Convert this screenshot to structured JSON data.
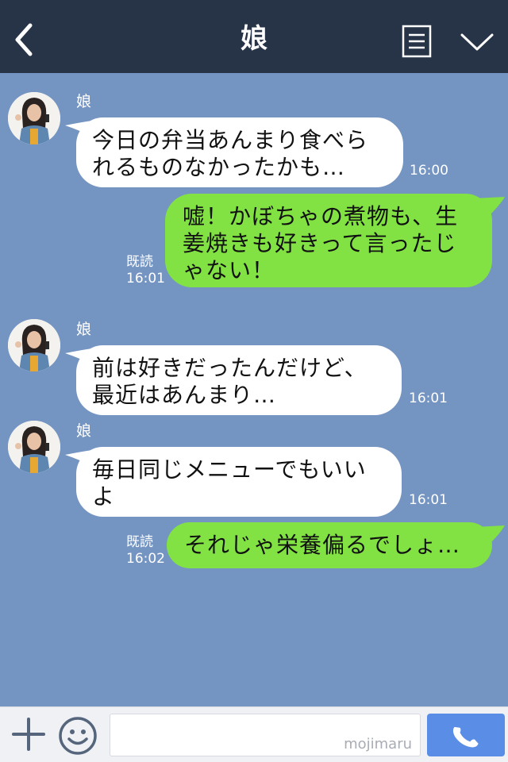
{
  "header": {
    "title": "娘",
    "back_icon": "chevron-left-icon",
    "note_icon": "note-icon",
    "menu_icon": "chevron-down-icon"
  },
  "messages": [
    {
      "side": "left",
      "sender": "娘",
      "lines": [
        "今日の弁当あんまり食べら",
        "れるものなかったかも…"
      ],
      "time": "16:00"
    },
    {
      "side": "right",
      "lines": [
        "嘘！かぼちゃの煮物も、生",
        "姜焼きも好きって言ったじ",
        "ゃない！"
      ],
      "read": "既読",
      "time": "16:01"
    },
    {
      "side": "left",
      "sender": "娘",
      "lines": [
        "前は好きだったんだけど、",
        "最近はあんまり…"
      ],
      "time": "16:01"
    },
    {
      "side": "left",
      "sender": "娘",
      "lines": [
        "毎日同じメニューでもいい",
        "よ"
      ],
      "time": "16:01"
    },
    {
      "side": "right",
      "lines": [
        "それじゃ栄養偏るでしょ…"
      ],
      "read": "既読",
      "time": "16:02"
    }
  ],
  "input": {
    "value": "",
    "watermark": "mojimaru"
  },
  "icons": {
    "plus": "plus-icon",
    "emoji": "smiley-icon",
    "call": "phone-icon"
  },
  "colors": {
    "header_bg": "#273347",
    "chat_bg": "#7494c2",
    "my_bubble": "#82e244",
    "their_bubble": "#ffffff",
    "call_button": "#5a8de6"
  }
}
